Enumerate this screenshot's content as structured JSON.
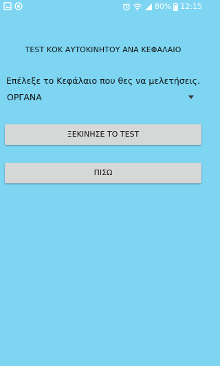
{
  "status_bar": {
    "battery": "80%",
    "time": "12:15",
    "left_icons": [
      "image-icon",
      "sync-icon"
    ],
    "right_icons": [
      "alarm-icon",
      "wifi-icon",
      "signal-icon",
      "battery-icon"
    ]
  },
  "screen": {
    "title": "TEST ΚΟΚ ΑΥΤΟΚΙΝΗΤΟΥ ΑΝΑ ΚΕΦΑΛΑΙΟ",
    "prompt": "Επέλεξε το Κεφάλαιο που θες να μελετήσεις.",
    "chapter_select": {
      "selected": "ΟΡΓΑΝΑ"
    },
    "start_button": "ΞΕΚΙΝΗΣΕ ΤΟ TEST",
    "back_button": "ΠΙΣΩ"
  },
  "colors": {
    "background": "#7dd5f2",
    "button": "#d6d7d7"
  }
}
